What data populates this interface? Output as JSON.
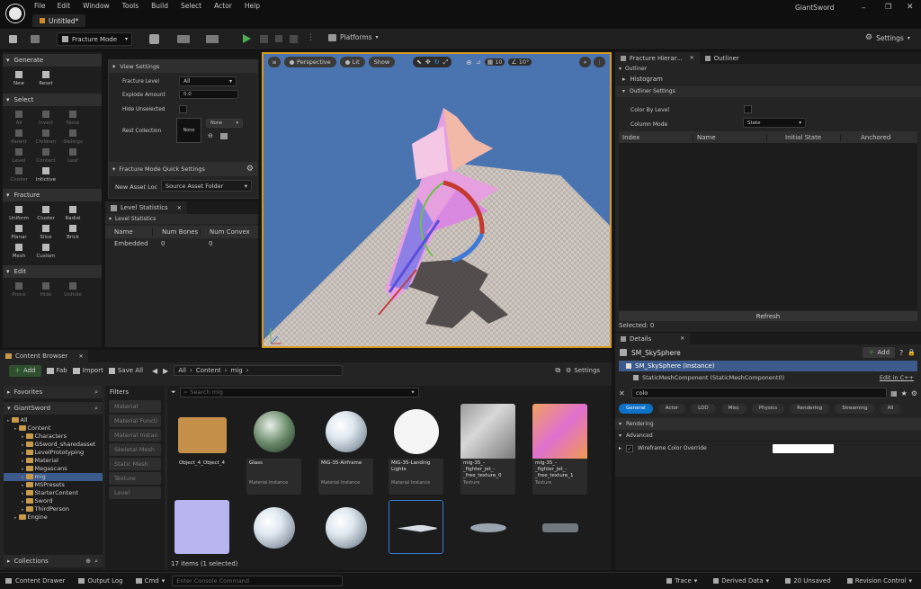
{
  "titlebar": {
    "menus": [
      "File",
      "Edit",
      "Window",
      "Tools",
      "Build",
      "Select",
      "Actor",
      "Help"
    ],
    "project": "GiantSword",
    "doc_tab": "Untitled*"
  },
  "toolbar": {
    "mode": "Fracture Mode",
    "platforms": "Platforms",
    "settings": "Settings"
  },
  "tools": {
    "generate": {
      "title": "Generate",
      "items": [
        "New",
        "Reset"
      ]
    },
    "select": {
      "title": "Select",
      "items": [
        "All",
        "Invert",
        "None",
        "Parent",
        "Children",
        "Siblings",
        "Level",
        "Contact",
        "Leaf",
        "Cluster",
        "Intictive"
      ]
    },
    "fracture": {
      "title": "Fracture",
      "items": [
        "Uniform",
        "Cluster",
        "Radial",
        "Planar",
        "Slice",
        "Brick",
        "Mesh",
        "Custom"
      ]
    },
    "edit": {
      "title": "Edit",
      "items": [
        "Prone",
        "Hide",
        "Unhide"
      ]
    }
  },
  "view_settings": {
    "title": "View Settings",
    "fracture_level_label": "Fracture Level",
    "fracture_level": "All",
    "explode_label": "Explode Amount",
    "explode": "0.0",
    "hide_unselected": "Hide Unselected",
    "rest_collection": "Rest Collection",
    "rest_none": "None",
    "rest_dropdown": "None"
  },
  "quick_settings": {
    "title": "Fracture Mode Quick Settings",
    "new_asset_label": "New Asset Loc",
    "new_asset_value": "Source Asset Folder"
  },
  "level_stats": {
    "tab": "Level Statistics",
    "section": "Level Statistics",
    "columns": [
      "Name",
      "Num Bones",
      "Num Convex"
    ],
    "rows": [
      [
        "Embedded",
        "0",
        "0"
      ]
    ]
  },
  "viewport": {
    "perspective": "Perspective",
    "lit": "Lit",
    "show": "Show",
    "grid_snap": "10",
    "rot_snap": "10°"
  },
  "fracture_hierarchy": {
    "tab": "Fracture Hierar...",
    "outliner_tab": "Outliner",
    "outliner": "Outliner",
    "histogram": "Histogram",
    "outliner_settings": "Outliner Settings",
    "color_by_level": "Color By Level",
    "column_mode_label": "Column Mode",
    "column_mode": "State",
    "columns": [
      "Index",
      "Name",
      "Initial State",
      "Anchored"
    ],
    "refresh": "Refresh",
    "selected": "Selected: 0"
  },
  "content_browser": {
    "tab": "Content Browser",
    "add": "Add",
    "fab": "Fab",
    "import": "Import",
    "save_all": "Save All",
    "path": [
      "All",
      "Content",
      "mig"
    ],
    "settings": "Settings",
    "favorites": "Favorites",
    "root": "GiantSword",
    "filters_title": "Filters",
    "search_placeholder": "Search mig",
    "collections": "Collections",
    "status": "17 items (1 selected)",
    "tree": [
      {
        "label": "All",
        "indent": 0
      },
      {
        "label": "Content",
        "indent": 1
      },
      {
        "label": "Characters",
        "indent": 2
      },
      {
        "label": "GSword_sharedasset",
        "indent": 2
      },
      {
        "label": "LevelPrototyping",
        "indent": 2
      },
      {
        "label": "Material",
        "indent": 2
      },
      {
        "label": "Megascans",
        "indent": 2
      },
      {
        "label": "mig",
        "indent": 2,
        "selected": true
      },
      {
        "label": "MSPresets",
        "indent": 2
      },
      {
        "label": "StarterContent",
        "indent": 2
      },
      {
        "label": "Sword",
        "indent": 2
      },
      {
        "label": "ThirdPerson",
        "indent": 2
      },
      {
        "label": "Engine",
        "indent": 1
      }
    ],
    "filters": [
      "Material",
      "Material Functi",
      "Material Instan",
      "Skeletal Mesh",
      "Static Mesh",
      "Texture",
      "Level"
    ],
    "assets": [
      {
        "name": "Object_4_Object_4",
        "type": ""
      },
      {
        "name": "Glass",
        "type": "Material Instance"
      },
      {
        "name": "MiG-35-Airframe",
        "type": "Material Instance"
      },
      {
        "name": "MiG-35-Landing Lights",
        "type": "Material Instance"
      },
      {
        "name": "mig-35_-_fighter_jet_-_free_texture_0",
        "type": "Texture"
      },
      {
        "name": "mig-35_-_fighter_jet_-_free_texture_1",
        "type": "Texture"
      }
    ]
  },
  "details": {
    "tab": "Details",
    "actor": "SM_SkySphere",
    "add": "Add",
    "instance": "SM_SkySphere (Instance)",
    "component": "StaticMeshComponent (StaticMeshComponent0)",
    "edit_cpp": "Edit in C++",
    "search": "colo",
    "tabs": [
      "General",
      "Actor",
      "LOD",
      "Misc",
      "Physics",
      "Rendering",
      "Streaming",
      "All"
    ],
    "rendering": "Rendering",
    "advanced": "Advanced",
    "prop": "Wireframe Color Override"
  },
  "statusbar": {
    "content_drawer": "Content Drawer",
    "output_log": "Output Log",
    "cmd": "Cmd",
    "console_placeholder": "Enter Console Command",
    "trace": "Trace",
    "derived_data": "Derived Data",
    "unsaved": "20 Unsaved",
    "revision": "Revision Control"
  }
}
